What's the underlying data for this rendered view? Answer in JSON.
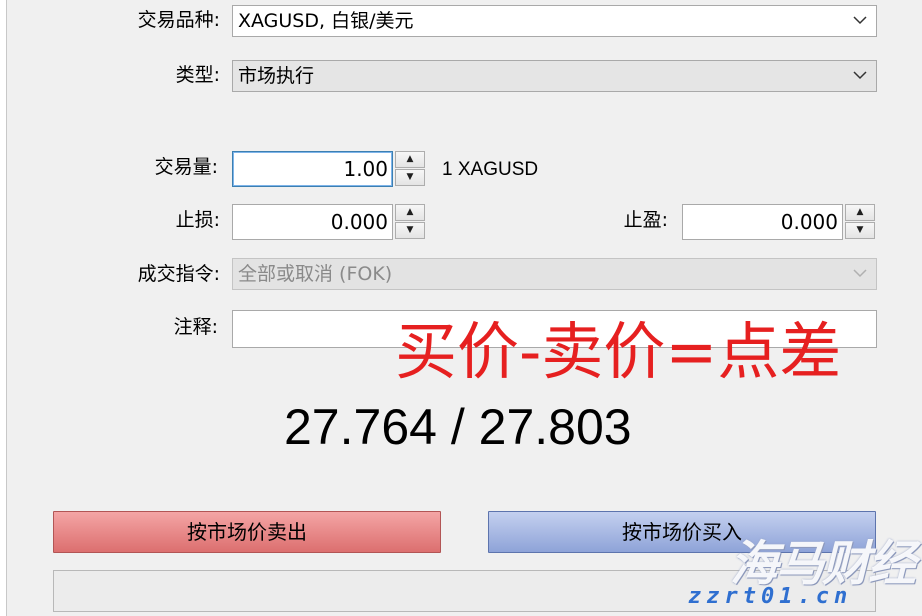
{
  "form": {
    "symbol": {
      "label": "交易品种:",
      "value": "XAGUSD, 白银/美元"
    },
    "type": {
      "label": "类型:",
      "value": "市场执行"
    },
    "volume": {
      "label": "交易量:",
      "value": "1.00",
      "unit": "1 XAGUSD"
    },
    "stop_loss": {
      "label": "止损:",
      "value": "0.000"
    },
    "take_profit": {
      "label": "止盈:",
      "value": "0.000"
    },
    "fill_policy": {
      "label": "成交指令:",
      "value": "全部或取消 (FOK)"
    },
    "comment": {
      "label": "注释:",
      "value": ""
    }
  },
  "annotation": "买价-卖价=点差",
  "quote": {
    "bid": "27.764",
    "separator": "/",
    "ask": "27.803"
  },
  "buttons": {
    "sell": "按市场价卖出",
    "buy": "按市场价买入"
  },
  "watermark": {
    "brand": "海马财经",
    "site": "zzrt01.cn"
  },
  "colors": {
    "sell": "#e07a7a",
    "buy": "#97a9da",
    "annotation": "#e62020",
    "focus": "#3c7fb1"
  }
}
